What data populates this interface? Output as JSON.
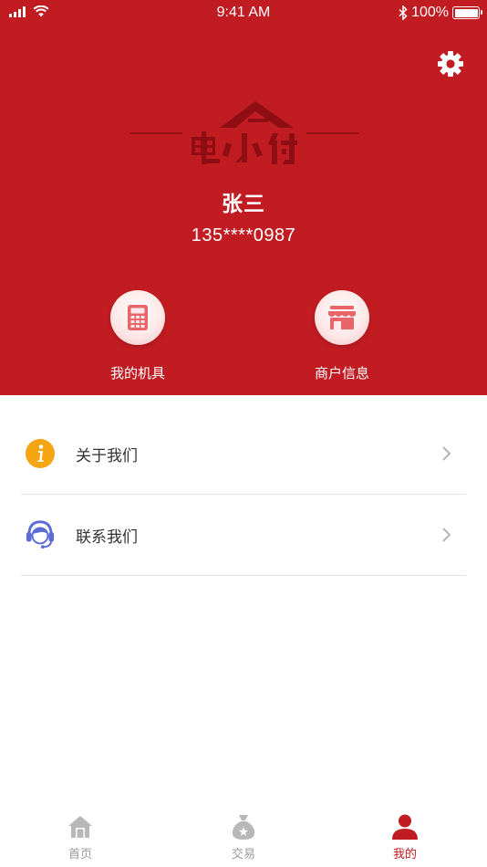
{
  "status_bar": {
    "time": "9:41 AM",
    "battery": "100%",
    "battery_level": 1.0
  },
  "profile": {
    "name": "张三",
    "phone": "135****0987"
  },
  "quick_actions": [
    {
      "label": "我的机具",
      "icon": "calculator-icon"
    },
    {
      "label": "商户信息",
      "icon": "store-icon"
    }
  ],
  "menu": [
    {
      "label": "关于我们",
      "icon": "info-icon",
      "icon_color": "#f5a511"
    },
    {
      "label": "联系我们",
      "icon": "customer-service-icon",
      "icon_color": "#5b6bd8"
    }
  ],
  "tabs": [
    {
      "label": "首页",
      "icon": "home-icon"
    },
    {
      "label": "交易",
      "icon": "money-bag-icon"
    },
    {
      "label": "我的",
      "icon": "person-icon",
      "active": true
    }
  ],
  "colors": {
    "brand": "#c01c22",
    "tab_inactive": "#9a9a9a",
    "divider": "#e3e3e3",
    "logo_dark": "#8e0e13"
  }
}
